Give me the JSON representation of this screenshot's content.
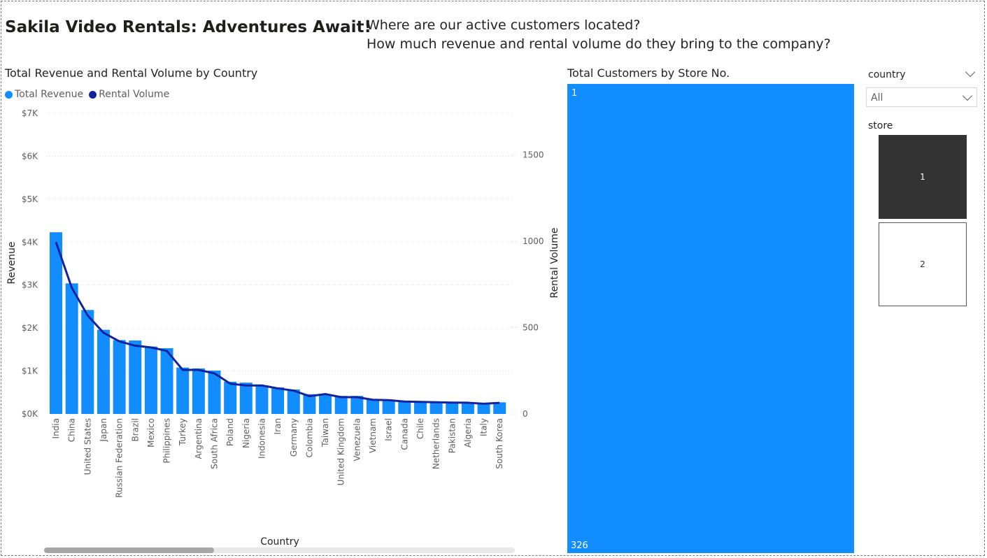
{
  "report": {
    "title": "Sakila Video Rentals: Adventures Await!",
    "question_1": "Where are our active customers located?",
    "question_2": "How much revenue and rental volume do they bring to the company?"
  },
  "combo_chart": {
    "title": "Total Revenue and Rental Volume by Country",
    "legend": [
      {
        "label": "Total Revenue",
        "color": "#118dff"
      },
      {
        "label": "Rental Volume",
        "color": "#12239e"
      }
    ],
    "ylabel": "Revenue",
    "y2label": "Rental Volume",
    "xlabel": "Country",
    "y_ticks": [
      "$0K",
      "$1K",
      "$2K",
      "$3K",
      "$4K",
      "$5K",
      "$6K",
      "$7K"
    ],
    "y2_ticks": [
      "0",
      "500",
      "1000",
      "1500"
    ]
  },
  "treemap": {
    "title": "Total Customers by Store No.",
    "category_label": "1",
    "value_label": "326",
    "color": "#118dff"
  },
  "country_slicer": {
    "header": "country",
    "selected_value": "All"
  },
  "store_slicer": {
    "header": "store",
    "tiles": [
      "1",
      "2"
    ],
    "selected": "1"
  },
  "chart_data": {
    "type": "bar",
    "title": "Total Revenue and Rental Volume by Country",
    "xlabel": "Country",
    "ylabel": "Revenue",
    "y2label": "Rental Volume",
    "categories": [
      "India",
      "China",
      "United States",
      "Japan",
      "Russian Federation",
      "Brazil",
      "Mexico",
      "Philippines",
      "Turkey",
      "Argentina",
      "South Africa",
      "Poland",
      "Nigeria",
      "Indonesia",
      "Iran",
      "Germany",
      "Colombia",
      "Taiwan",
      "United Kingdom",
      "Venezuela",
      "Vietnam",
      "Israel",
      "Canada",
      "Chile",
      "Netherlands",
      "Pakistan",
      "Algeria",
      "Italy",
      "South Korea"
    ],
    "ylim": [
      0,
      7000
    ],
    "y2lim": [
      0,
      1740
    ],
    "series": [
      {
        "name": "Total Revenue",
        "type": "bar",
        "axis": "left",
        "color": "#118dff",
        "values": [
          4230,
          3040,
          2420,
          1960,
          1720,
          1710,
          1570,
          1530,
          1080,
          1060,
          1010,
          750,
          730,
          650,
          620,
          570,
          460,
          450,
          420,
          420,
          340,
          330,
          300,
          290,
          280,
          270,
          260,
          250,
          270
        ]
      },
      {
        "name": "Rental Volume",
        "type": "line",
        "axis": "right",
        "color": "#12239e",
        "values": [
          995,
          730,
          570,
          470,
          420,
          395,
          385,
          365,
          255,
          255,
          235,
          175,
          165,
          165,
          148,
          135,
          103,
          115,
          97,
          97,
          82,
          80,
          72,
          70,
          68,
          66,
          65,
          59,
          64
        ]
      }
    ]
  }
}
